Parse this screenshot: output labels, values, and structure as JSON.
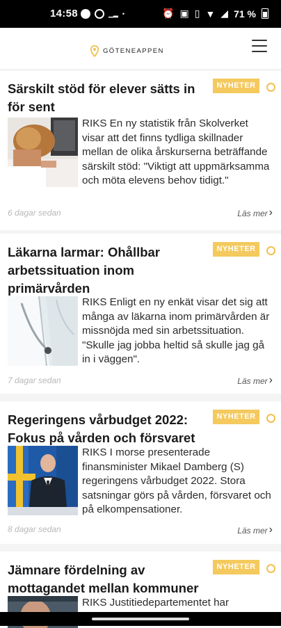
{
  "status_bar": {
    "time": "14:58",
    "battery": "71 %",
    "icons": [
      "chat-bubble-icon",
      "ring-icon",
      "dot-icon",
      "alarm-icon",
      "nfc-icon",
      "vibrate-icon",
      "wifi-icon",
      "signal-icon",
      "battery-icon"
    ]
  },
  "header": {
    "logo_text": "GÖTENEAPPEN",
    "brand_color": "#f2c04f",
    "menu_icon": "hamburger-menu-icon"
  },
  "articles": [
    {
      "title": "Särskilt stöd för elever sätts in för sent",
      "category": "NYHETER",
      "summary": "RIKS En ny statistik från Skolverket visar att det finns tydliga skillnader mellan de olika årskurserna beträffande särskilt stöd: \"Viktigt att uppmärksamma och möta elevens behov tidigt.\"",
      "date": "6 dagar sedan",
      "read_more": "Läs mer",
      "image": "stressed-student-photo"
    },
    {
      "title": "Läkarna larmar: Ohållbar arbetssituation inom primärvården",
      "category": "NYHETER",
      "summary": "RIKS Enligt en ny enkät visar det sig att många av läkarna inom primärvården är missnöjda med sin arbetssituation. \"Skulle jag jobba heltid så skulle jag gå in i väggen\".",
      "date": "7 dagar sedan",
      "read_more": "Läs mer",
      "image": "doctor-stethoscope-photo"
    },
    {
      "title": "Regeringens vårbudget 2022: Fokus på vården och försvaret",
      "category": "NYHETER",
      "summary": "RIKS I morse presenterade finansminister Mikael Damberg (S) regeringens vårbudget 2022. Stora satsningar görs på vården, försvaret och på elkompensationer.",
      "date": "8 dagar sedan",
      "read_more": "Läs mer",
      "image": "minister-press-photo"
    },
    {
      "title": "Jämnare fördelning av mottagandet mellan kommuner",
      "category": "NYHETER",
      "summary": "RIKS Justitiedepartementet har",
      "image": "politician-photo"
    }
  ]
}
